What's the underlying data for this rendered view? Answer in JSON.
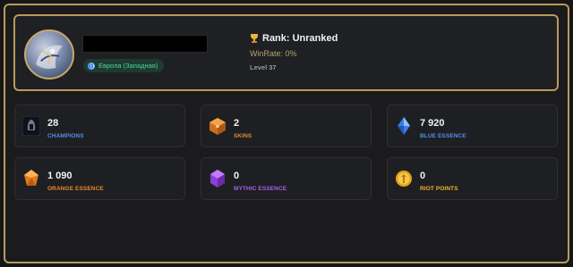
{
  "profile": {
    "region": "Европа (Западная)",
    "rank_label": "Rank: Unranked",
    "winrate": "WinRate: 0%",
    "level": "Level 37"
  },
  "stats": [
    {
      "value": "28",
      "label": "CHAMPIONS",
      "icon": "champion-helmet-icon",
      "color": "#4f8ff0"
    },
    {
      "value": "2",
      "label": "SKINS",
      "icon": "skin-chest-icon",
      "color": "#e08a2f"
    },
    {
      "value": "7 920",
      "label": "BLUE ESSENCE",
      "icon": "blue-essence-icon",
      "color": "#4f8ff0"
    },
    {
      "value": "1 090",
      "label": "ORANGE ESSENCE",
      "icon": "orange-essence-icon",
      "color": "#e8892d"
    },
    {
      "value": "0",
      "label": "MYTHIC ESSENCE",
      "icon": "mythic-essence-icon",
      "color": "#a861e8"
    },
    {
      "value": "0",
      "label": "RIOT POINTS",
      "icon": "riot-points-icon",
      "color": "#f0b52a"
    }
  ]
}
